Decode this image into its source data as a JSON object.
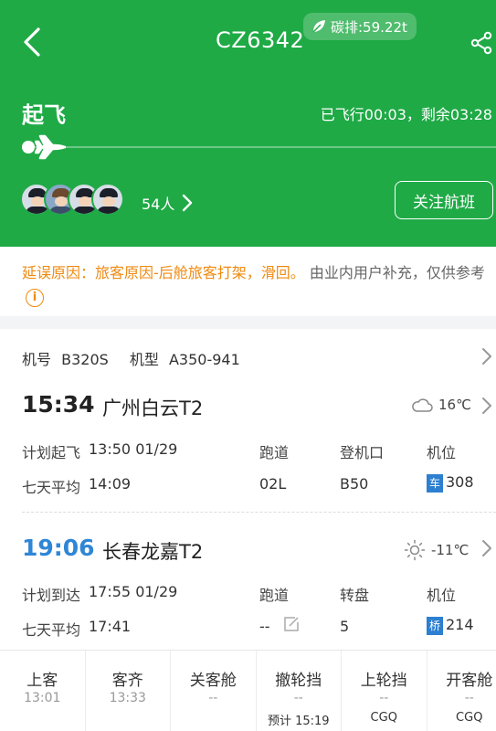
{
  "header": {
    "flight_no": "CZ6342",
    "carbon": "碳排:59.22t",
    "status": "起飞",
    "elapsed": "已飞行00:03，剩余03:28",
    "passengers_count": "54人",
    "follow_label": "关注航班"
  },
  "delay": {
    "reason": "延误原因：旅客原因-后舱旅客打架，滑回。",
    "note": "由业内用户补充，仅供参考"
  },
  "aircraft": {
    "reg_label": "机号",
    "reg": "B320S",
    "type_label": "机型",
    "type": "A350-941"
  },
  "departure": {
    "time": "15:34",
    "airport": "广州白云T2",
    "weather_icon": "cloud-icon",
    "temp": "16℃",
    "planned_label": "计划起飞",
    "planned": "13:50 01/29",
    "avg_label": "七天平均",
    "avg": "14:09",
    "runway_label": "跑道",
    "runway": "02L",
    "gate_label": "登机口",
    "gate": "B50",
    "stand_label": "机位",
    "stand_tag": "车",
    "stand": "308"
  },
  "arrival": {
    "time": "19:06",
    "airport": "长春龙嘉T2",
    "weather_icon": "sun-icon",
    "temp": "-11℃",
    "planned_label": "计划到达",
    "planned": "17:55 01/29",
    "avg_label": "七天平均",
    "avg": "17:41",
    "runway_label": "跑道",
    "runway": "--",
    "carousel_label": "转盘",
    "carousel": "5",
    "stand_label": "机位",
    "stand_tag": "桥",
    "stand": "214"
  },
  "steps": [
    {
      "name": "上客",
      "value": "13:01",
      "extra": ""
    },
    {
      "name": "客齐",
      "value": "13:33",
      "extra": ""
    },
    {
      "name": "关客舱",
      "value": "--",
      "extra": ""
    },
    {
      "name": "撤轮挡",
      "value": "--",
      "extra": "预计 15:19"
    },
    {
      "name": "上轮挡",
      "value": "--",
      "extra": "CGQ"
    },
    {
      "name": "开客舱",
      "value": "--",
      "extra": "CGQ"
    }
  ],
  "colors": {
    "header_bg": "#1faa46",
    "delay_text": "#ef8a10",
    "departure_time": "#222222",
    "arrival_time": "#2f86d6",
    "tag_blue": "#2d7fd0"
  }
}
